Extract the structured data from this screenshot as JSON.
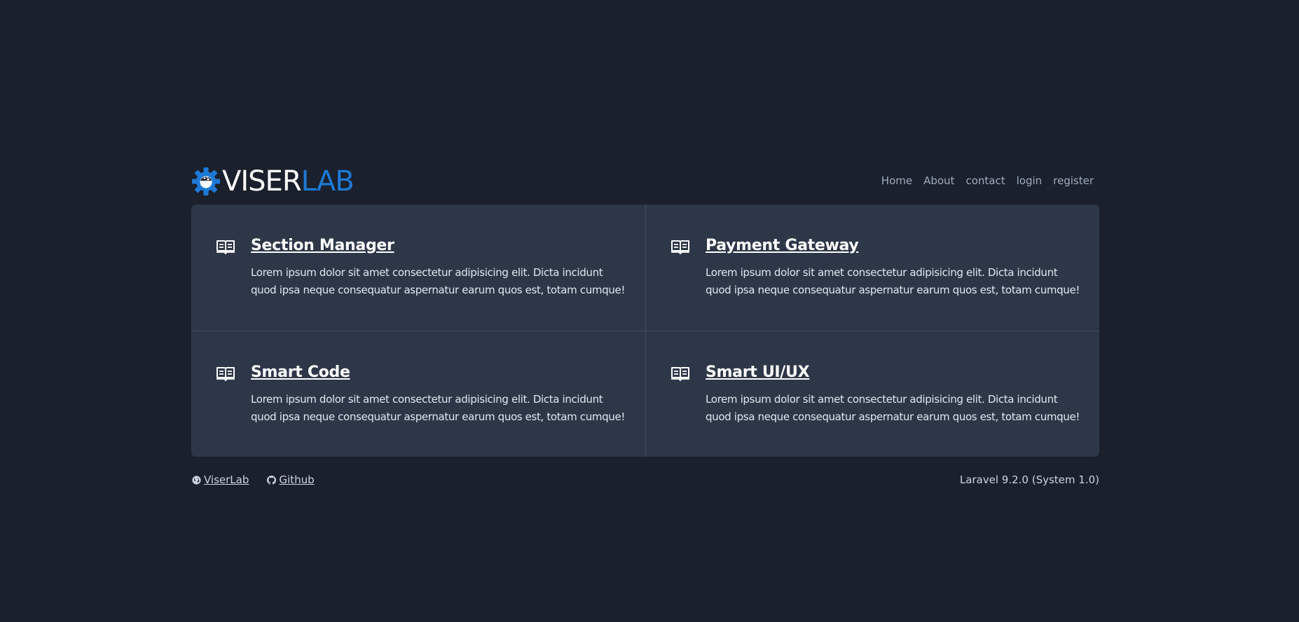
{
  "brand": {
    "part1": "VISER",
    "part2": "LAB",
    "accent_color": "#1e7ad6",
    "icon": "gear-icon"
  },
  "nav": {
    "items": [
      {
        "label": "Home"
      },
      {
        "label": "About"
      },
      {
        "label": "contact"
      },
      {
        "label": "login"
      },
      {
        "label": "register"
      }
    ]
  },
  "cards": [
    {
      "icon": "book-open-icon",
      "title": "Section Manager",
      "text": "Lorem ipsum dolor sit amet consectetur adipisicing elit. Dicta incidunt quod ipsa neque consequatur aspernatur earum quos est, totam cumque!"
    },
    {
      "icon": "book-open-icon",
      "title": "Payment Gateway",
      "text": "Lorem ipsum dolor sit amet consectetur adipisicing elit. Dicta incidunt quod ipsa neque consequatur aspernatur earum quos est, totam cumque!"
    },
    {
      "icon": "book-open-icon",
      "title": "Smart Code",
      "text": "Lorem ipsum dolor sit amet consectetur adipisicing elit. Dicta incidunt quod ipsa neque consequatur aspernatur earum quos est, totam cumque!"
    },
    {
      "icon": "book-open-icon",
      "title": "Smart UI/UX",
      "text": "Lorem ipsum dolor sit amet consectetur adipisicing elit. Dicta incidunt quod ipsa neque consequatur aspernatur earum quos est, totam cumque!"
    }
  ],
  "footer": {
    "links": [
      {
        "label": " ViserLab",
        "icon": "globe-icon"
      },
      {
        "label": " Github",
        "icon": "github-icon"
      }
    ],
    "version": "Laravel 9.2.0 (System 1.0)"
  },
  "colors": {
    "background": "#1a202c",
    "panel": "#2d3748",
    "divider": "#404b5e"
  }
}
